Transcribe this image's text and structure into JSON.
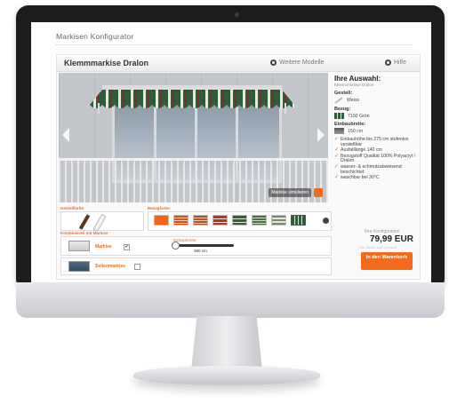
{
  "page_title": "Markisen Konfigurator",
  "product": {
    "title": "Klemmmarkise Dralon",
    "more_models": "Weitere Modelle",
    "help": "Hilfe"
  },
  "scene": {
    "simulate_label": "Markise simulieren"
  },
  "selection": {
    "heading": "Ihre Auswahl:",
    "subheading": "Klemmmarkise Dralon",
    "frame_label": "Gestell:",
    "frame_value": "Weiss",
    "cover_label": "Bezug:",
    "cover_value": "7100 Grün",
    "width_label": "Einbaubreite:",
    "width_value": "150 cm"
  },
  "features": [
    "Einbauhöhe bis 275 cm stufenlos verstellbar",
    "Ausfalllänge 140 cm",
    "Bezugstoff Qualität 100% Polyacryl / Dralon",
    "wasser- & schmutzabweisend beschichtet",
    "waschbar bei 30°C"
  ],
  "config": {
    "label": "Ihre Konfiguration",
    "price": "79,99 EUR",
    "price_note": "inkl. MwSt. zzgl. Versand",
    "cart_button": "In den Warenkorb"
  },
  "frame_colors": {
    "label": "Gestellfarbe:",
    "options": [
      "Braun",
      "Weiss"
    ],
    "colors": [
      "#5a3820",
      "#f4f4f4"
    ]
  },
  "fabrics": {
    "label": "Bezugfarbe:",
    "colors": [
      "#f3641c",
      "#d2531d",
      "#a9572a",
      "#b83426",
      "#34613a",
      "#4d6f45",
      "#7c8a6c",
      "#2f5c3a"
    ],
    "more_icon": "arrow-right-icon"
  },
  "combine": {
    "label": "Kombinieren mit Markise",
    "item1_label": "Markise",
    "item1_checked": "✔",
    "slider_label": "Einbaubreite:",
    "slider_value": "360 cm",
    "slider_position": 0.1,
    "item2_label": "Seitenmarkise",
    "item2_checked": ""
  },
  "colors": {
    "accent": "#f26a1b",
    "bezel": "#1c1c1e"
  }
}
